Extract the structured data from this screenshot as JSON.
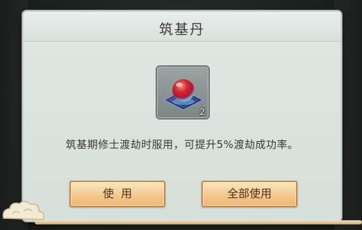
{
  "dialog": {
    "title": "筑基丹",
    "item": {
      "icon": "red-blue-pill-icon",
      "count": "2"
    },
    "description": "筑基期修士渡劫时服用，可提升5%渡劫成功率。",
    "buttons": {
      "use_label": "使用",
      "use_all_label": "全部使用"
    }
  },
  "colors": {
    "panel": "#dde5e1",
    "button_fill": "#f4c98c",
    "button_border": "#c98a45",
    "pill_red": "#d8262a",
    "pill_blue": "#7fc7e6"
  }
}
